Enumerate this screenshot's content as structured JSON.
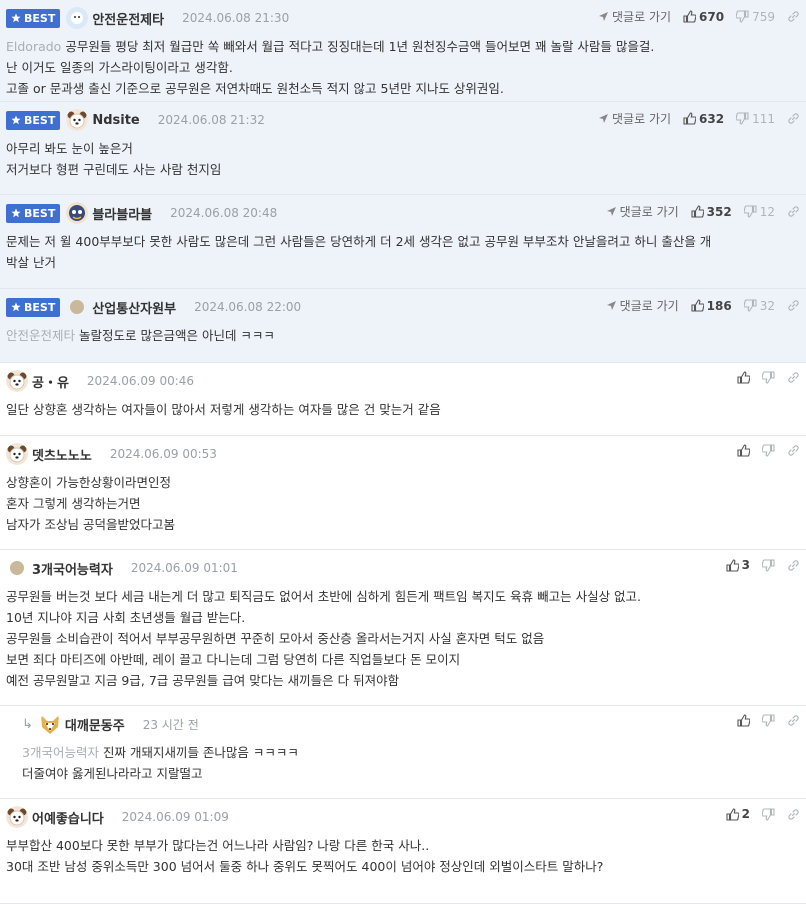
{
  "best_label": "BEST",
  "reply_label": "댓글로 가기",
  "comments": [
    {
      "type": "best",
      "nick": "안전운전제타",
      "date": "2024.06.08 21:30",
      "likes": "670",
      "dislikes": "759",
      "mention": "Eldorado",
      "lines": [
        "공무원들 평당 최저 월급만 쏙 빼와서 월급 적다고 징징대는데 1년 원천징수금액 들어보면 꽤 놀랄 사람들 많을걸.",
        "난 이거도 일종의 가스라이팅이라고 생각함.",
        "고졸 or 문과생 출신 기준으로 공무원은 저연차때도 원천소득 적지 않고 5년만 지나도 상위권임."
      ]
    },
    {
      "type": "best",
      "nick": "Ndsite",
      "date": "2024.06.08 21:32",
      "likes": "632",
      "dislikes": "111",
      "lines": [
        "아무리 봐도 눈이 높은거",
        "저거보다 형편 구린데도 사는 사람 천지임"
      ]
    },
    {
      "type": "best",
      "nick": "블라블라블",
      "date": "2024.06.08 20:48",
      "likes": "352",
      "dislikes": "12",
      "lines": [
        "문제는 저 윌 400부부보다 못한 사람도 많은데 그런 사람들은 당연하게 더 2세 생각은 없고 공무원 부부조차 안날을려고 하니 출산을 개",
        "박살 난거"
      ]
    },
    {
      "type": "best",
      "nick": "산업통산자원부",
      "date": "2024.06.08 22:00",
      "likes": "186",
      "dislikes": "32",
      "mention": "안전운전제타",
      "lines": [
        "놀랄정도로 많은금액은 아닌데 ㅋㅋㅋ"
      ]
    },
    {
      "type": "normal",
      "nick": "공・유",
      "date": "2024.06.09 00:46",
      "lines": [
        "일단 상향혼 생각하는 여자들이 많아서 저렇게 생각하는 여자들 많은 건 맞는거 같음"
      ]
    },
    {
      "type": "normal",
      "nick": "뎃츠노노노",
      "date": "2024.06.09 00:53",
      "lines": [
        "상향혼이 가능한상황이라면인정",
        "혼자 그렇게 생각하는거면",
        "남자가 조상님 공덕을받었다고봄"
      ]
    },
    {
      "type": "normal",
      "nick": "3개국어능력자",
      "date": "2024.06.09 01:01",
      "likes": "3",
      "lines": [
        "공무원들 버는것 보다 세금 내는게 더 많고 퇴직금도 없어서 초반에 심하게 힘든게 팩트임 복지도 육휴 빼고는 사실상 없고.",
        "10년 지나야 지금 사회 초년생들 월급 받는다.",
        "공무원들 소비습관이 적어서 부부공무원하면 꾸준히 모아서 중산층 올라서는거지 사실 혼자면 턱도 없음",
        "보면 죄다 마티즈에 아반떼, 레이 끌고 다니는데 그럼 당연히 다른 직업들보다 돈 모이지",
        "예전 공무원말고 지금 9급, 7급 공무원들 급여 맞다는 새끼들은 다 뒤져야함"
      ]
    },
    {
      "type": "reply",
      "nick": "대깨문동주",
      "date": "23 시간 전",
      "mention": "3개국어능력자",
      "lines": [
        "진짜 개돼지새끼들 존나많음 ㅋㅋㅋㅋ",
        "더줄여야 옳게된나라라고 지랄떨고"
      ]
    },
    {
      "type": "normal",
      "nick": "어예좋습니다",
      "date": "2024.06.09 01:09",
      "likes": "2",
      "lines": [
        "부부합산 400보다 못한 부부가 많다는건 어느나라 사람임? 나랑 다른 한국 사나..",
        "30대 조반 남성 중위소득만 300 넘어서 둘중 하나 중위도 못찍어도 400이 넘어야 정상인데 외벌이스타트 말하나?"
      ]
    }
  ],
  "colors": {
    "best_bg": "#eef3fa",
    "badge": "#3e6fd1",
    "border": "#e3e6ea"
  },
  "icons": [
    "star-icon",
    "reply-arrow-icon",
    "thumbs-up-icon",
    "thumbs-down-icon",
    "link-icon",
    "avatar-icon"
  ]
}
